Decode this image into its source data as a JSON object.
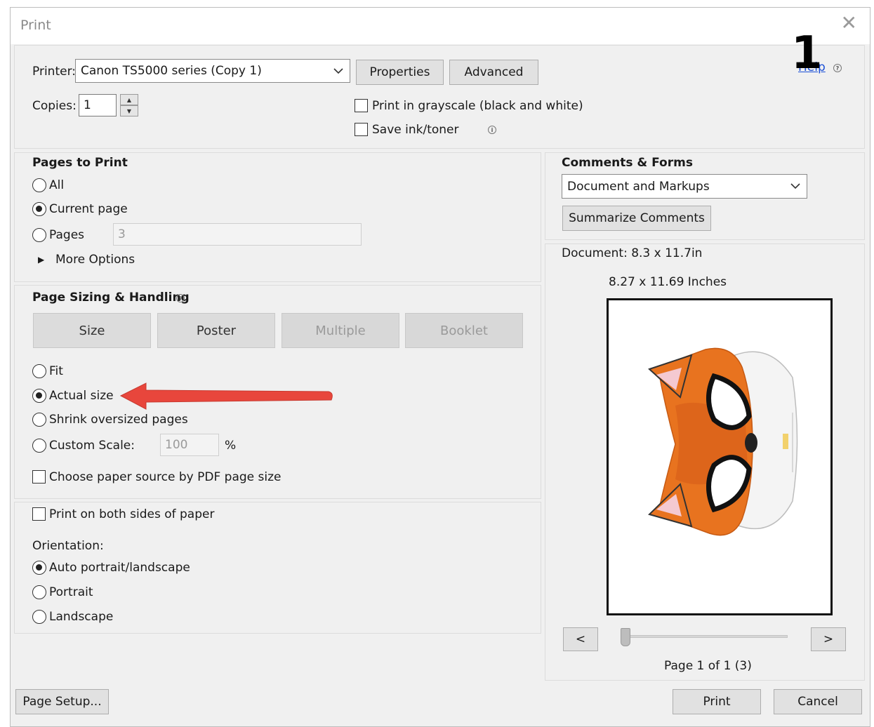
{
  "window": {
    "title": "Print",
    "close_glyph": "✕"
  },
  "annotation": {
    "step_number": "1"
  },
  "printer": {
    "label": "Printer:",
    "selected": "Canon TS5000 series (Copy 1)",
    "properties_label": "Properties",
    "advanced_label": "Advanced",
    "help_label": "Help"
  },
  "copies": {
    "label": "Copies:",
    "value": "1"
  },
  "options": {
    "grayscale_label": "Print in grayscale (black and white)",
    "grayscale_checked": false,
    "save_ink_label": "Save ink/toner",
    "save_ink_checked": false
  },
  "pages_to_print": {
    "heading": "Pages to Print",
    "all_label": "All",
    "current_label": "Current page",
    "pages_label": "Pages",
    "pages_value": "3",
    "more_options_label": "More Options",
    "selected": "current"
  },
  "sizing": {
    "heading": "Page Sizing & Handling",
    "tabs": [
      {
        "label": "Size",
        "enabled": true
      },
      {
        "label": "Poster",
        "enabled": true
      },
      {
        "label": "Multiple",
        "enabled": false
      },
      {
        "label": "Booklet",
        "enabled": false
      }
    ],
    "fit_label": "Fit",
    "actual_label": "Actual size",
    "shrink_label": "Shrink oversized pages",
    "custom_label": "Custom Scale:",
    "custom_value": "100",
    "percent_label": "%",
    "paper_source_label": "Choose paper source by PDF page size",
    "selected": "actual"
  },
  "duplex": {
    "label": "Print on both sides of paper",
    "checked": false
  },
  "orientation": {
    "heading": "Orientation:",
    "auto_label": "Auto portrait/landscape",
    "portrait_label": "Portrait",
    "landscape_label": "Landscape",
    "selected": "auto"
  },
  "comments": {
    "heading": "Comments & Forms",
    "selected": "Document and Markups",
    "summarize_label": "Summarize Comments"
  },
  "preview": {
    "document_size": "Document: 8.3 x 11.7in",
    "paper_size": "8.27 x 11.69 Inches",
    "prev_label": "<",
    "next_label": ">",
    "page_status": "Page 1 of 1 (3)",
    "image": "fox-mask-preview"
  },
  "footer": {
    "page_setup_label": "Page Setup...",
    "print_label": "Print",
    "cancel_label": "Cancel"
  },
  "colors": {
    "accent_arrow": "#e8463c",
    "fox_orange": "#e8731f",
    "link_blue": "#1a4fd6"
  }
}
